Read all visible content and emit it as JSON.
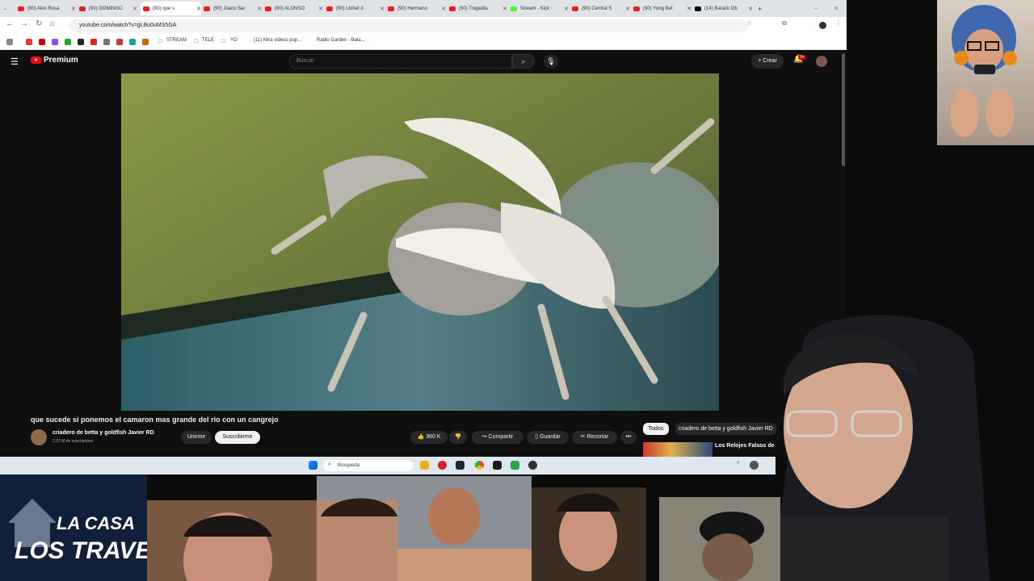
{
  "browser": {
    "tabs": [
      {
        "label": "(90) Alex Rosa",
        "active": false
      },
      {
        "label": "(90) DOMINGO",
        "active": false
      },
      {
        "label": "(90) que s",
        "active": true
      },
      {
        "label": "(90) Joaco Sar",
        "active": false
      },
      {
        "label": "(90) ALONSO",
        "active": false
      },
      {
        "label": "(90) Llobet d",
        "active": false
      },
      {
        "label": "(90) Hermano",
        "active": false
      },
      {
        "label": "(90) Tragedia",
        "active": false
      },
      {
        "label": "Stream - Kick",
        "active": false
      },
      {
        "label": "(90) Central S",
        "active": false
      },
      {
        "label": "(90) Yung Bet",
        "active": false
      },
      {
        "label": "(14) Barack Ob",
        "active": false
      }
    ],
    "new_tab": "+",
    "url": "youtube.com/watch?v=gLBu0uMS5GA",
    "bookmarks": [
      "STREAM",
      "TELE",
      "YO",
      "(11) Mira videos pup...",
      "Radio Garden - Bala..."
    ]
  },
  "youtube": {
    "logo_text": "Premium",
    "search_placeholder": "Buscar",
    "create_label": "Crear",
    "notif_badge": "9+",
    "video_title": "que sucede si ponemos el camaron mas grande del rio con un cangrejo",
    "channel_name": "criadero de betta y goldfish Javier RD",
    "subscribers": "2,02 M de suscriptores",
    "join_label": "Unirme",
    "subscribe_label": "Suscribirme",
    "likes": "360 K",
    "share_label": "Compartir",
    "save_label": "Guardar",
    "clip_label": "Recortar",
    "more_label": "•••",
    "chips": [
      "Todos",
      "criadero de betta y goldfish Javier RD"
    ],
    "recommended_title": "Los Relojes Falsos de"
  },
  "taskbar": {
    "search_placeholder": "Búsqueda"
  },
  "overlay": {
    "banner_line1": "LA CASA",
    "banner_line2": "LOS TRAVELO"
  },
  "colors": {
    "youtube_red": "#ff0000",
    "yt_bg": "#0f0f0f",
    "chrome_bg": "#dfe3e8"
  }
}
